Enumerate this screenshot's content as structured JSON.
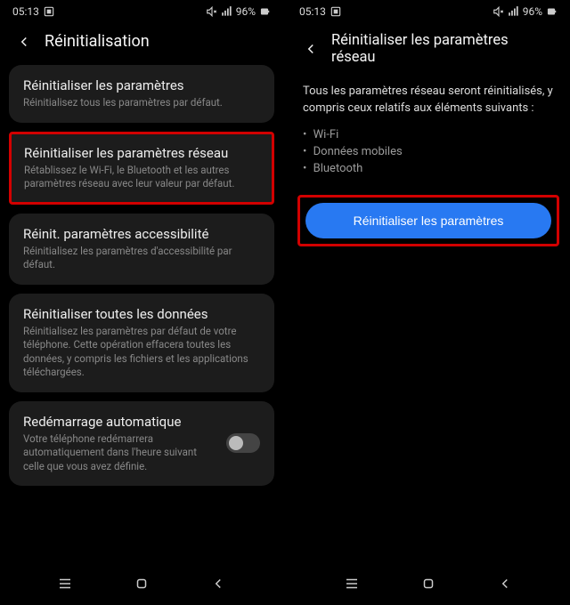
{
  "status": {
    "time": "05:13",
    "battery": "96%"
  },
  "left": {
    "title": "Réinitialisation",
    "items": {
      "params": {
        "title": "Réinitialiser les paramètres",
        "desc": "Réinitialisez tous les paramètres par défaut."
      },
      "network": {
        "title": "Réinitialiser les paramètres réseau",
        "desc": "Rétablissez le Wi-Fi, le Bluetooth et les autres paramètres réseau avec leur valeur par défaut."
      },
      "accessibility": {
        "title": "Réinit. paramètres accessibilité",
        "desc": "Réinitialisez les paramètres d'accessibilité par défaut."
      },
      "allData": {
        "title": "Réinitialiser toutes les données",
        "desc": "Réinitialisez les paramètres par défaut de votre téléphone. Cette opération effacera toutes les données, y compris les fichiers et les applications téléchargées."
      },
      "autoRestart": {
        "title": "Redémarrage automatique",
        "desc": "Votre téléphone redémarrera automatiquement dans l'heure suivant celle que vous avez définie."
      }
    }
  },
  "right": {
    "title": "Réinitialiser les paramètres réseau",
    "info": "Tous les paramètres réseau seront réinitialisés, y compris ceux relatifs aux éléments suivants :",
    "bullets": {
      "wifi": "Wi-Fi",
      "mobile": "Données mobiles",
      "bt": "Bluetooth"
    },
    "button": "Réinitialiser les paramètres"
  }
}
